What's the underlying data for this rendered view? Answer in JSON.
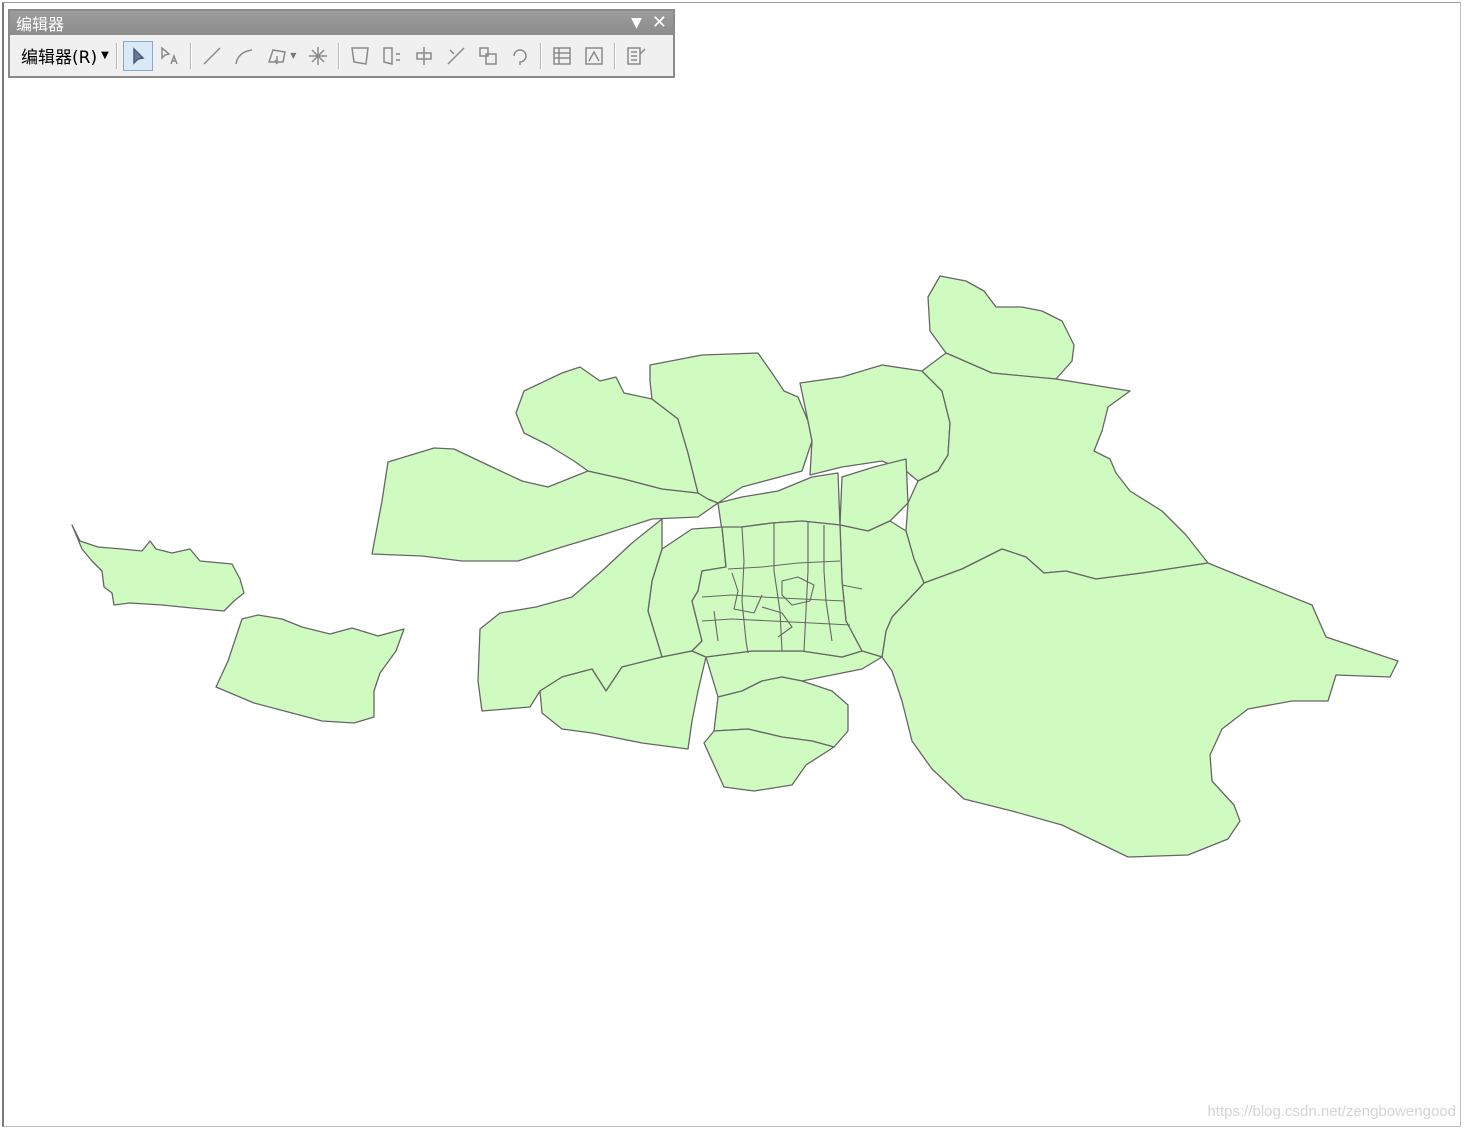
{
  "toolbar": {
    "title": "编辑器",
    "menu_label": "编辑器(R)",
    "icons": [
      "edit-tool-icon",
      "edit-annotation-tool-icon",
      "straight-segment-icon",
      "end-point-arc-icon",
      "trace-construct-icon",
      "midpoint-icon",
      "edit-vertices-icon",
      "reshape-feature-icon",
      "cut-polygons-icon",
      "split-tool-icon",
      "rotate-tool-icon",
      "attributes-icon",
      "sketch-properties-icon",
      "create-features-icon"
    ]
  },
  "map": {
    "fill_color": "#d0fbc0",
    "outline_color": "#666666"
  },
  "watermark": "https://blog.csdn.net/zengbowengood"
}
